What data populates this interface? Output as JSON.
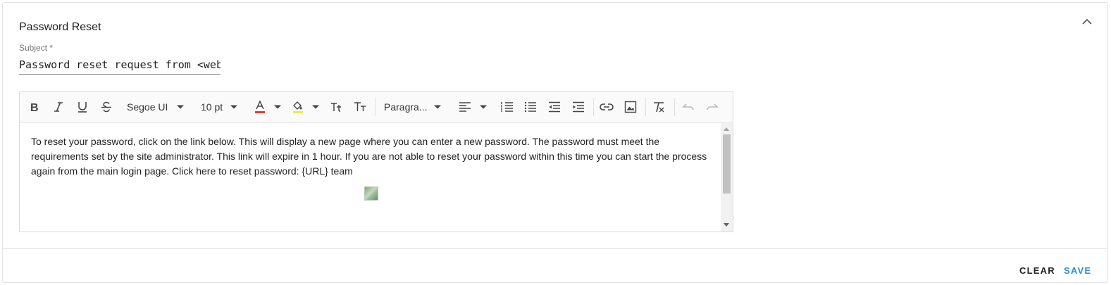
{
  "section": {
    "title": "Password Reset"
  },
  "subject": {
    "label": "Subject *",
    "value": "Password reset request from <website>"
  },
  "toolbar": {
    "font_family": "Segoe UI",
    "font_size": "10 pt",
    "block_format": "Paragra...",
    "font_color": "#e53935",
    "highlight_color": "#f5e642",
    "icons": [
      "bold-icon",
      "italic-icon",
      "underline-icon",
      "strikethrough-icon",
      "font-color-icon",
      "highlight-icon",
      "subscript-icon",
      "font-case-icon",
      "align-left-icon",
      "numbered-list-icon",
      "bullet-list-icon",
      "outdent-icon",
      "indent-icon",
      "link-icon",
      "image-icon",
      "clear-format-icon",
      "undo-icon",
      "redo-icon"
    ]
  },
  "editor": {
    "body_text": "To reset your password, click on the link below.  This will display a new page where you can enter a new password.  The password must meet the requirements set by the site administrator.  This link will expire in 1 hour.  If you are not able to reset your password within this time you can start the process again from the main login page.    Click here to reset password: {URL}   team"
  },
  "actions": {
    "clear_label": "CLEAR",
    "save_label": "SAVE",
    "accent_color": "#2f8fd6"
  }
}
